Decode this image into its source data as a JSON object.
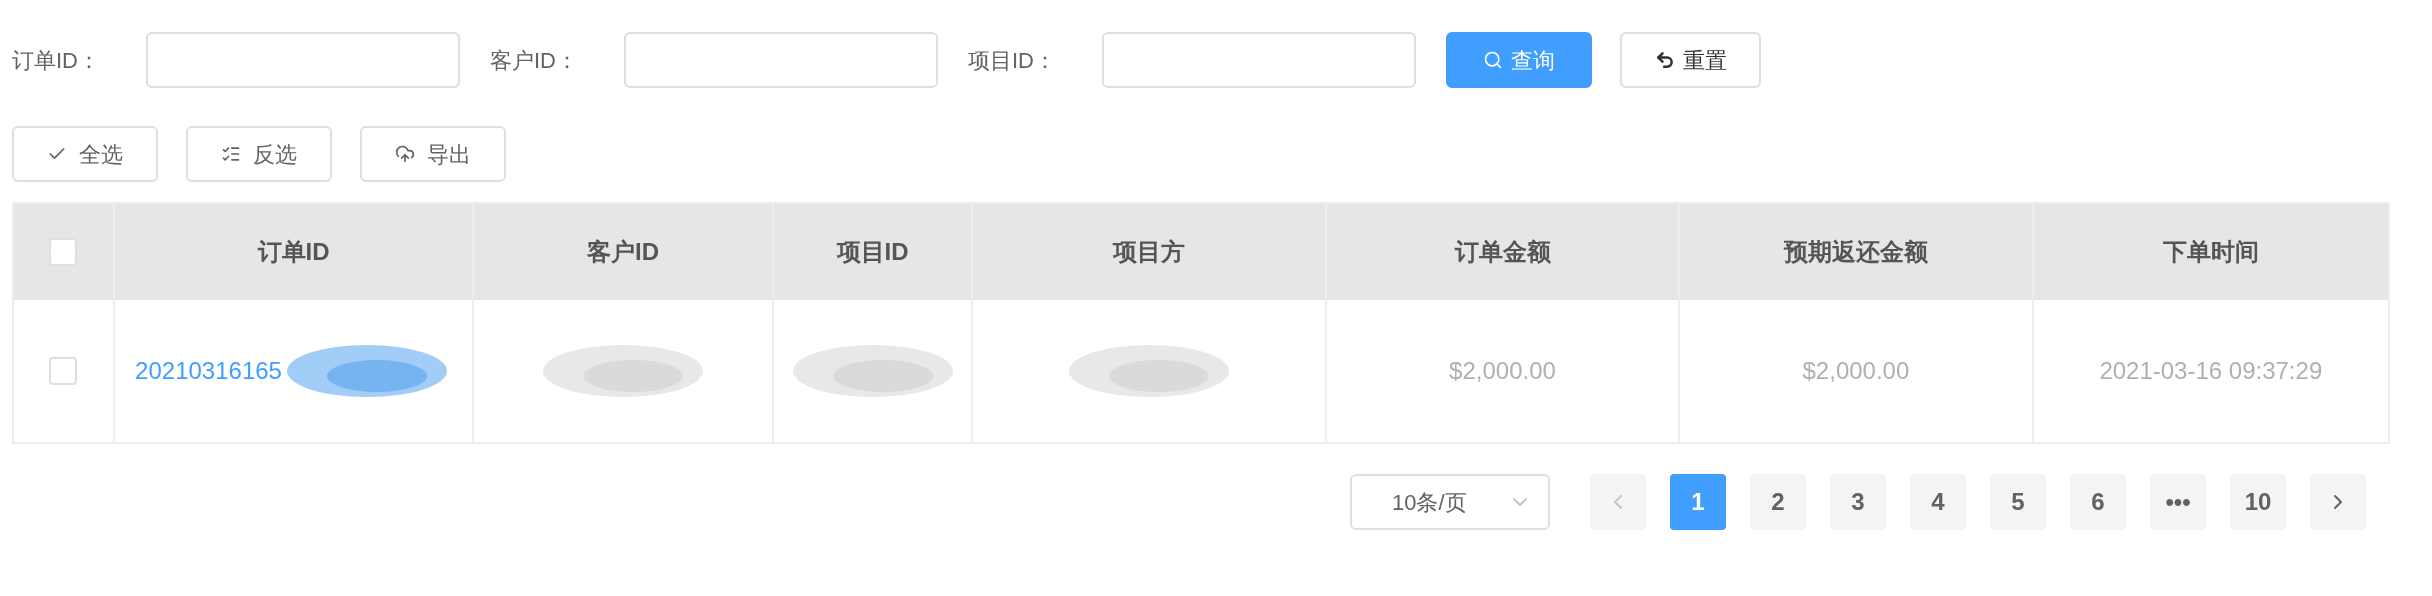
{
  "filters": [
    {
      "label": "订单ID："
    },
    {
      "label": "客户ID："
    },
    {
      "label": "项目ID："
    }
  ],
  "filter_buttons": [
    {
      "kind": "search",
      "label": "查询"
    },
    {
      "kind": "reset",
      "label": "重置"
    }
  ],
  "action_buttons": [
    {
      "kind": "check",
      "label": "全选"
    },
    {
      "kind": "invert",
      "label": "反选"
    },
    {
      "kind": "export",
      "label": "导出"
    }
  ],
  "table": {
    "header_checked": false,
    "columns": [
      "订单ID",
      "客户ID",
      "项目ID",
      "项目方",
      "订单金额",
      "预期返还金额",
      "下单时间"
    ],
    "rows": [
      {
        "selected": false,
        "cells": [
          {
            "kind": "link",
            "text": "20210316165",
            "redacted": true
          },
          {
            "kind": "text",
            "redacted": true
          },
          {
            "kind": "text",
            "redacted": true
          },
          {
            "kind": "text",
            "redacted": true
          },
          {
            "kind": "text",
            "text": "$2,000.00"
          },
          {
            "kind": "text",
            "text": "$2,000.00"
          },
          {
            "kind": "text",
            "text": "2021-03-16 09:37:29"
          }
        ]
      }
    ]
  },
  "pagination": {
    "page_size": "10条/页",
    "pages": [
      {
        "label": "1",
        "selected": true
      },
      {
        "label": "2",
        "selected": false
      },
      {
        "label": "3",
        "selected": false
      },
      {
        "label": "4",
        "selected": false
      },
      {
        "label": "5",
        "selected": false
      },
      {
        "label": "6",
        "selected": false
      },
      {
        "label": "•••",
        "selected": false
      },
      {
        "label": "10",
        "selected": false
      }
    ]
  }
}
